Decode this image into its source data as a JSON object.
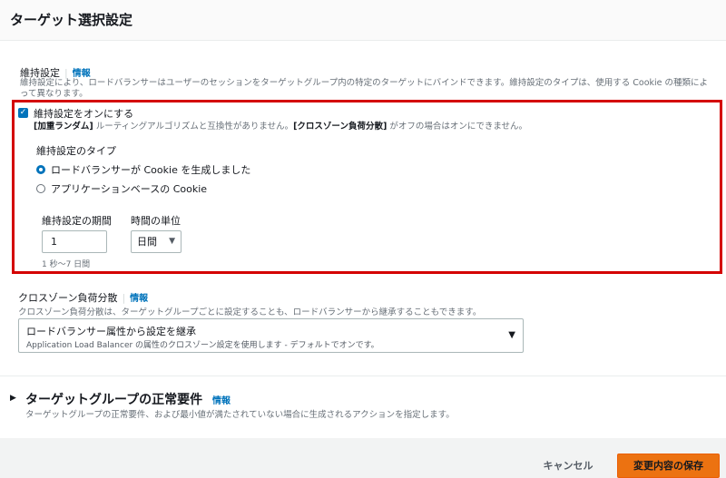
{
  "header": {
    "title": "ターゲット選択設定"
  },
  "stickiness": {
    "label": "維持設定",
    "info": "情報",
    "description": "維持設定により、ロードバランサーはユーザーのセッションをターゲットグループ内の特定のターゲットにバインドできます。維持設定のタイプは、使用する Cookie の種類によって異なります。",
    "checkbox_label": "維持設定をオンにする",
    "checkbox_checked": true,
    "checkbox_note_b1": "[加重ランダム]",
    "checkbox_note_t1": " ルーティングアルゴリズムと互換性がありません。",
    "checkbox_note_b2": "[クロスゾーン負荷分散]",
    "checkbox_note_t2": " がオフの場合はオンにできません。",
    "type_label": "維持設定のタイプ",
    "option_lb": "ロードバランサーが Cookie を生成しました",
    "option_app": "アプリケーションベースの Cookie",
    "selected_option": "option_lb",
    "duration_label": "維持設定の期間",
    "duration_value": "1",
    "unit_label": "時間の単位",
    "unit_value": "日間",
    "duration_hint": "1 秒〜7 日間"
  },
  "cross_zone": {
    "label": "クロスゾーン負荷分散",
    "info": "情報",
    "description": "クロスゾーン負荷分散は、ターゲットグループごとに設定することも、ロードバランサーから継承することもできます。",
    "select_value": "ロードバランサー属性から設定を継承",
    "select_subtext": "Application Load Balancer の属性のクロスゾーン設定を使用します - デフォルトでオンです。"
  },
  "health": {
    "title": "ターゲットグループの正常要件",
    "info": "情報",
    "description": "ターゲットグループの正常要件、および最小値が満たされていない場合に生成されるアクションを指定します。"
  },
  "footer": {
    "cancel_label": "キャンセル",
    "save_label": "変更内容の保存"
  },
  "colors": {
    "accent": "#0073bb",
    "highlight_border": "#d40000",
    "primary_button": "#ec7211"
  }
}
